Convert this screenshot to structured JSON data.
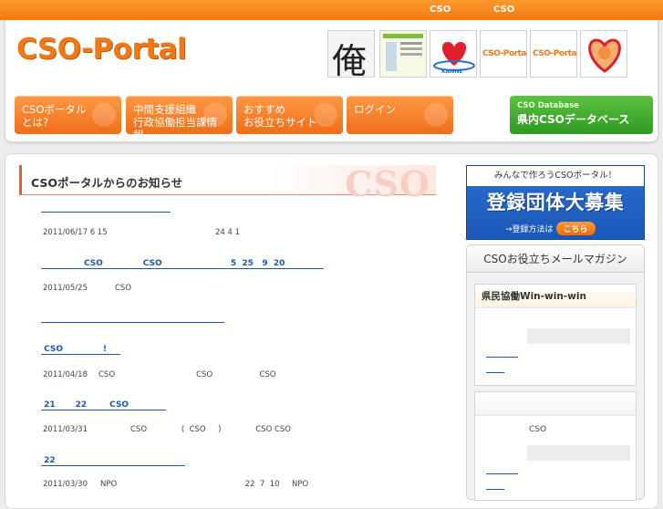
{
  "topbar": {
    "link1": "CSO",
    "link2": "CSO"
  },
  "site": {
    "logo": "CSO-Portal"
  },
  "banners": [
    {
      "name": "ore-banner",
      "glyph": "俺"
    },
    {
      "name": "newsletter-banner",
      "glyph": ""
    },
    {
      "name": "kanne-banner",
      "glyph": "KANNE"
    },
    {
      "name": "cso-portal-banner-1",
      "glyph": "CSO-Portal"
    },
    {
      "name": "cso-portal-banner-2",
      "glyph": "CSO-Portal"
    },
    {
      "name": "heart-banner",
      "glyph": ""
    }
  ],
  "nav": {
    "about": {
      "line1": "CSOポータル",
      "line2": "とは?"
    },
    "support": {
      "line1": "中間支援組織",
      "line2": "行政協働担当課情報"
    },
    "recommend": {
      "line1": "おすすめ",
      "line2": "お役立ちサイト"
    },
    "login": {
      "line1": "ログイン"
    },
    "database": {
      "small": "CSO Database",
      "big": "県内CSOデータベース"
    }
  },
  "news": {
    "title": "CSOポータルからのお知らせ",
    "watermark": "CSO",
    "items": [
      {
        "link": "                              ",
        "date": "2011/06/17 6 15",
        "desc": "24 4 1",
        "desc_offset": ""
      },
      {
        "link": "               CSO              CSO                        5  25   9  20 ",
        "date": "2011/05/25",
        "desc": "CSO",
        "desc_offset": ""
      },
      {
        "link": "                                                ",
        "date": "",
        "desc": "",
        "desc_offset": ""
      },
      {
        "link": " CSO              !",
        "date": "2011/04/18",
        "desc": "CSO                                 CSO                   CSO",
        "desc_offset": ""
      },
      {
        "link": " 21       22        CSO         ",
        "date": "2011/03/31",
        "desc": "CSO              (  CSO     )              CSO CSO",
        "desc_offset": ""
      },
      {
        "link": " 22                                  ",
        "date": "2011/03/30",
        "desc": "NPO                                                    22  7  10     NPO",
        "desc_offset": ""
      }
    ]
  },
  "recruit": {
    "top": "みんなで作ろうCSOポータル！",
    "mid": "登録団体大募集",
    "bottom": "→登録方法は",
    "button": "こちら"
  },
  "magazine": {
    "title": "CSOお役立ちメールマガジン",
    "box1_title": "県民協働Win-win-win",
    "box2_text": "CSO"
  },
  "colors": {
    "orange": "#f07818",
    "green": "#2d9a22",
    "blue": "#1a5aa8"
  }
}
